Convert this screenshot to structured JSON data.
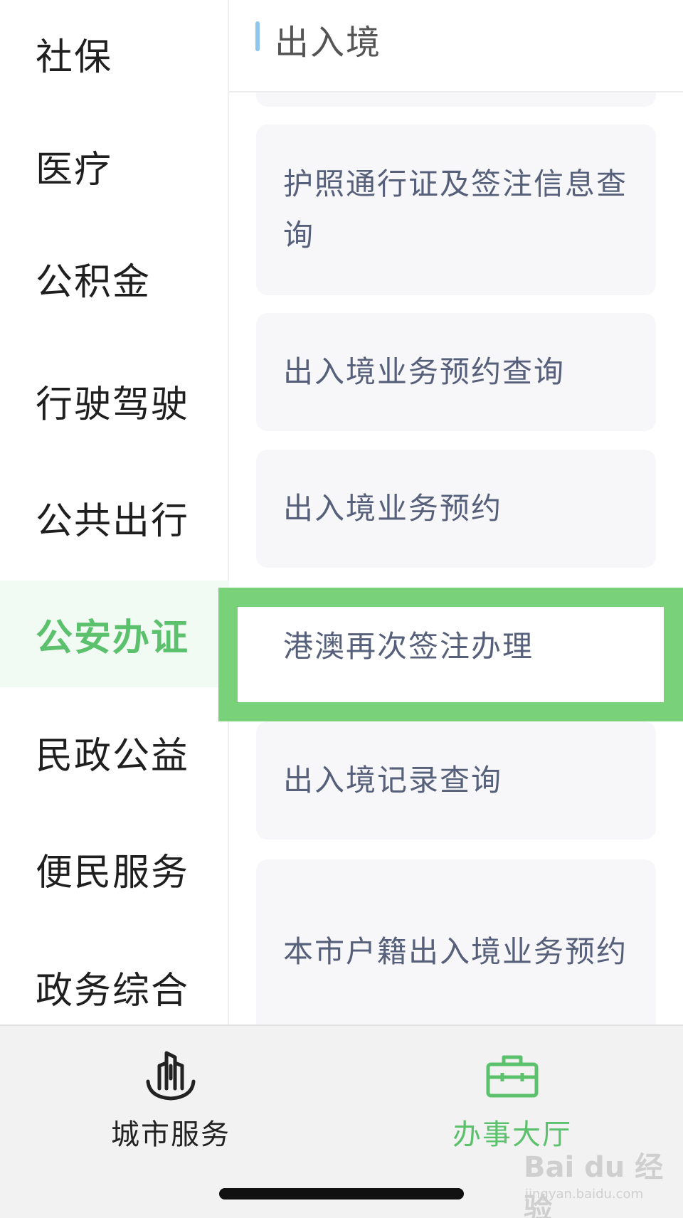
{
  "sidebar": {
    "items": [
      {
        "label": "社保"
      },
      {
        "label": "医疗"
      },
      {
        "label": "公积金"
      },
      {
        "label": "行驶驾驶"
      },
      {
        "label": "公共出行"
      },
      {
        "label": "公安办证",
        "active": true
      },
      {
        "label": "民政公益"
      },
      {
        "label": "便民服务"
      },
      {
        "label": "政务综合"
      }
    ]
  },
  "content": {
    "section_title": "出入境",
    "cards": [
      {
        "label": "护照通行证及签注信息查询"
      },
      {
        "label": "出入境业务预约查询"
      },
      {
        "label": "出入境业务预约"
      },
      {
        "label": "港澳再次签注办理",
        "highlighted": true
      },
      {
        "label": "出入境记录查询"
      },
      {
        "label": "本市户籍出入境业务预约"
      }
    ]
  },
  "tabbar": {
    "tabs": [
      {
        "label": "城市服务",
        "icon": "city-buildings-icon",
        "active": false
      },
      {
        "label": "办事大厅",
        "icon": "briefcase-icon",
        "active": true
      }
    ]
  },
  "watermark": {
    "main": "Bai du 经验",
    "sub": "jingyan.baidu.com"
  },
  "colors": {
    "accent": "#5cc16c",
    "highlight": "#79d179",
    "card_text": "#56607a",
    "card_bg": "#f7f7fa"
  }
}
